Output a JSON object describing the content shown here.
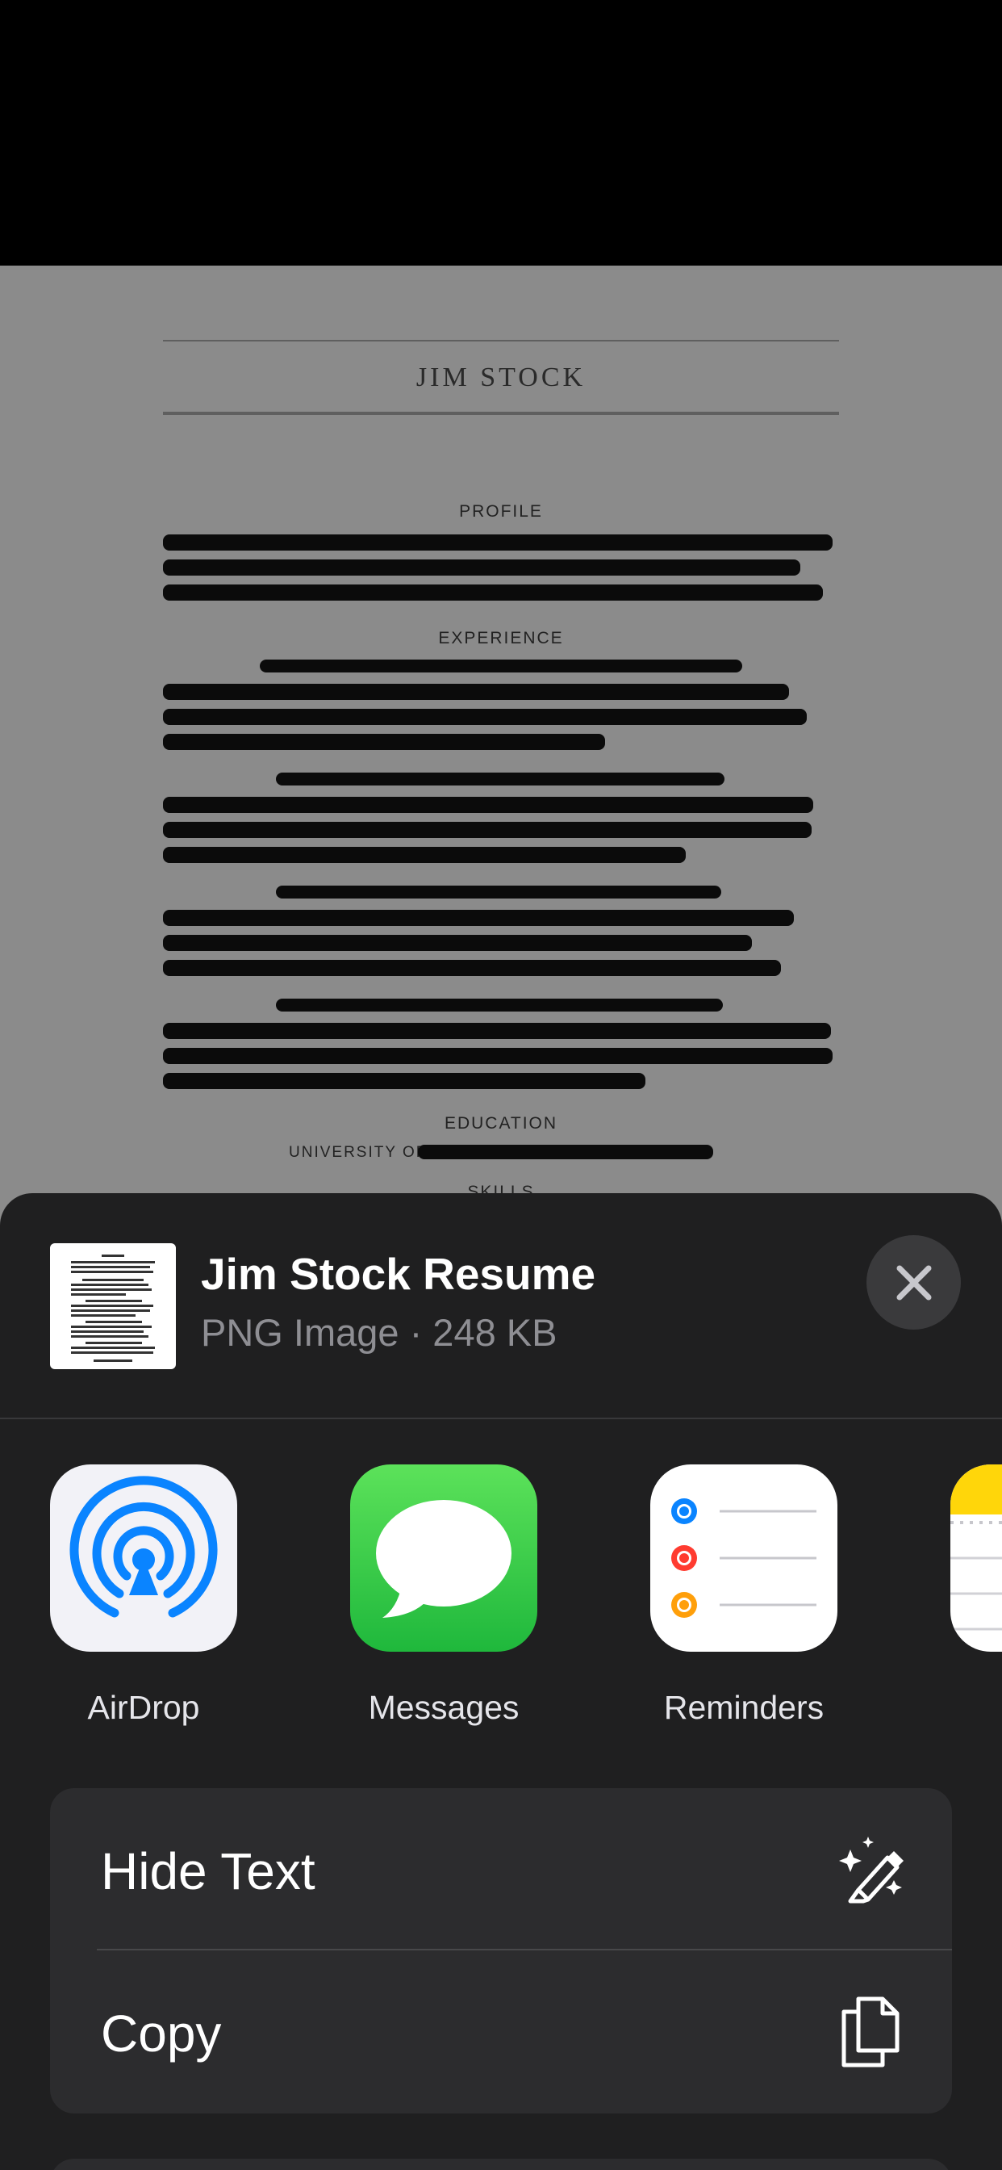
{
  "preview": {
    "name": "JIM STOCK",
    "sections": {
      "profile": "PROFILE",
      "experience": "EXPERIENCE",
      "education": "EDUCATION",
      "skills": "SKILLS"
    },
    "university_label": "UNIVERSITY OF"
  },
  "share_sheet": {
    "file_title": "Jim Stock Resume",
    "file_subtitle": "PNG Image · 248 KB",
    "apps": [
      {
        "label": "AirDrop",
        "icon": "airdrop-icon"
      },
      {
        "label": "Messages",
        "icon": "messages-icon"
      },
      {
        "label": "Reminders",
        "icon": "reminders-icon"
      },
      {
        "label": "",
        "icon": "notes-icon"
      }
    ],
    "actions": [
      {
        "label": "Hide Text",
        "icon": "highlighter-sparkle-icon"
      },
      {
        "label": "Copy",
        "icon": "copy-icon"
      }
    ]
  },
  "colors": {
    "sheet_background": "#1f1f20",
    "card_background": "#2c2c2e",
    "airdrop_blue": "#0a84ff",
    "messages_green": "#34c759",
    "reminders_blue": "#0a84ff",
    "reminders_red": "#ff3b30",
    "reminders_orange": "#ff9f0a",
    "notes_yellow": "#ffd60a"
  }
}
